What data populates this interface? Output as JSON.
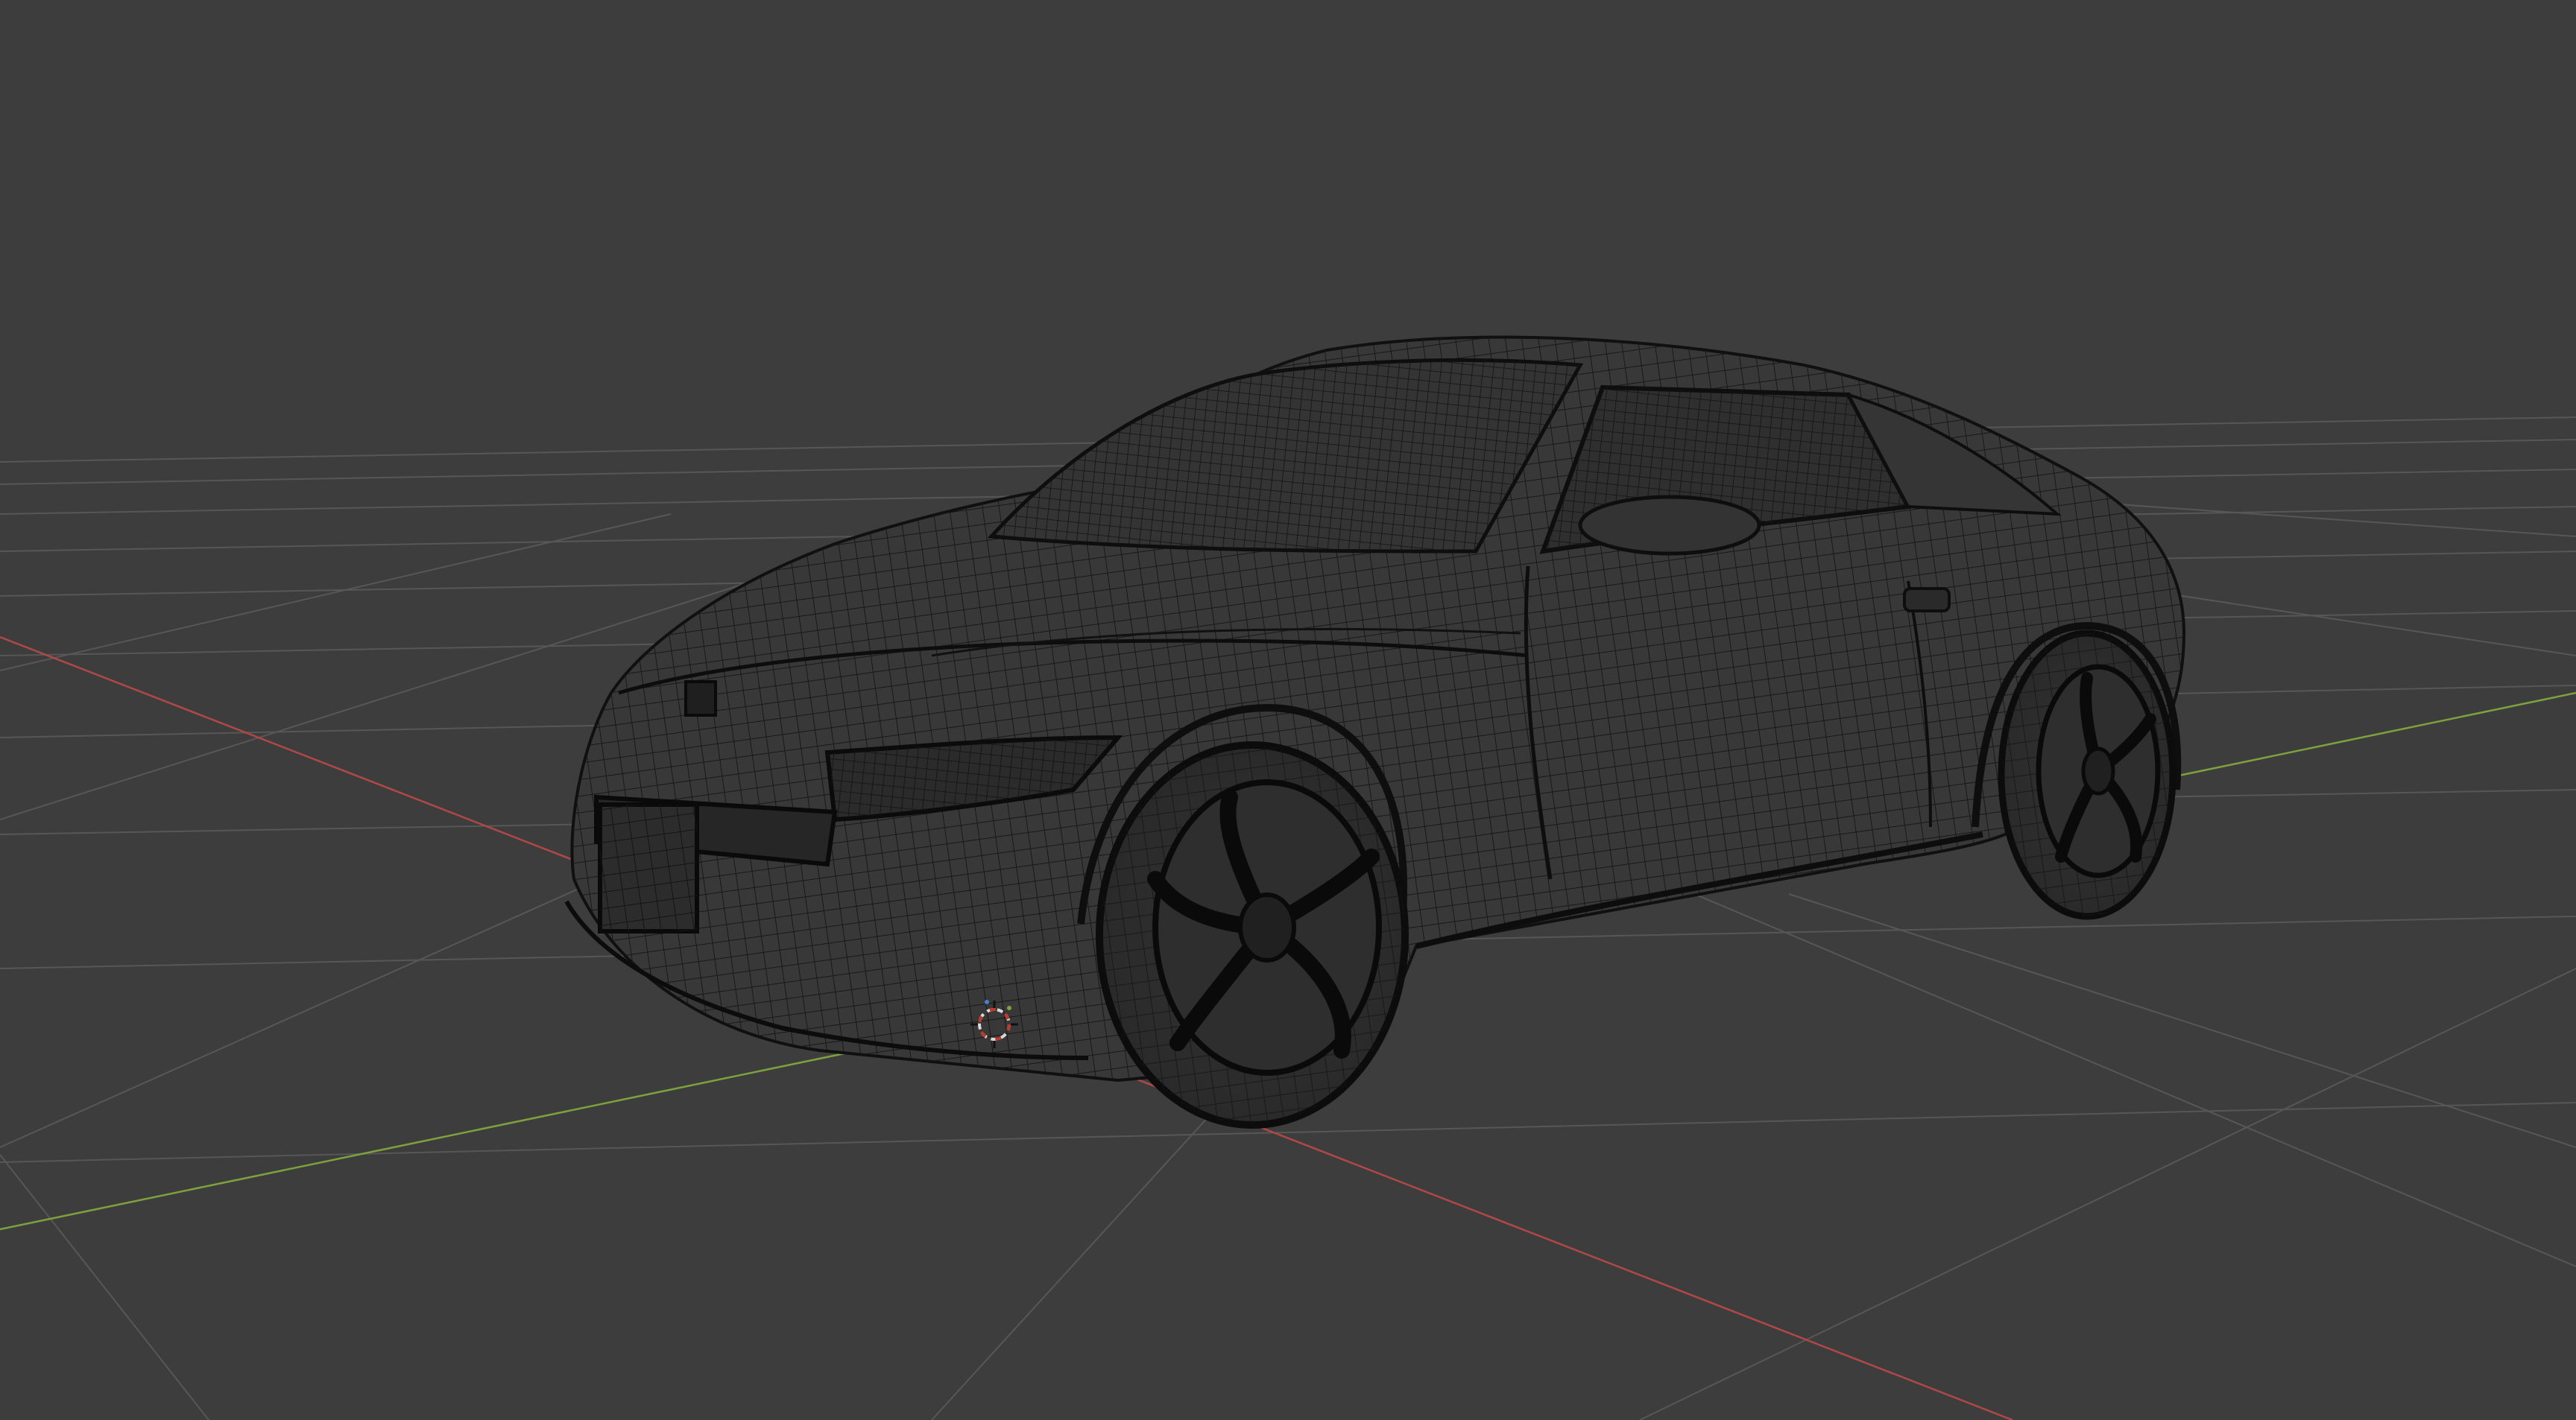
{
  "viewport": {
    "mode": "wireframe",
    "background": "#3d3d3d",
    "grid_color": "#5a5a5a",
    "x_axis_color": "#b24a4a",
    "y_axis_color": "#7fa33f",
    "wire_color": "#151515",
    "body_color": "#3a3a3a"
  },
  "scene": {
    "object": "car-mesh",
    "cursor_icon": "3d-cursor-icon"
  }
}
